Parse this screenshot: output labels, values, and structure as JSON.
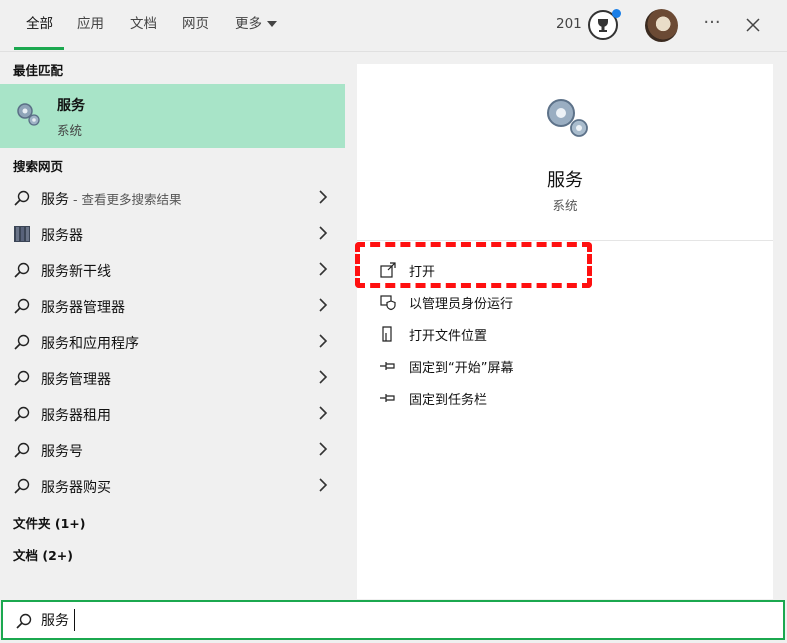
{
  "tabs": [
    {
      "label": "全部",
      "active": true
    },
    {
      "label": "应用"
    },
    {
      "label": "文档"
    },
    {
      "label": "网页"
    },
    {
      "label": "更多"
    }
  ],
  "header": {
    "points": "201",
    "more_icon": "ellipsis-icon",
    "close_icon": "close-icon"
  },
  "sections": {
    "best_match": "最佳匹配",
    "search_web": "搜索网页",
    "folders": "文件夹 (1+)",
    "documents": "文档 (2+)"
  },
  "best_match": {
    "title": "服务",
    "subtitle": "系统",
    "icon": "services-gear-icon"
  },
  "web_results": [
    {
      "label": "服务",
      "hint": " - 查看更多搜索结果",
      "icon": "search-icon"
    },
    {
      "label": "服务器",
      "hint": "",
      "icon": "server-image-icon"
    },
    {
      "label": "服务新干线",
      "hint": "",
      "icon": "search-icon"
    },
    {
      "label": "服务器管理器",
      "hint": "",
      "icon": "search-icon"
    },
    {
      "label": "服务和应用程序",
      "hint": "",
      "icon": "search-icon"
    },
    {
      "label": "服务管理器",
      "hint": "",
      "icon": "search-icon"
    },
    {
      "label": "服务器租用",
      "hint": "",
      "icon": "search-icon"
    },
    {
      "label": "服务号",
      "hint": "",
      "icon": "search-icon"
    },
    {
      "label": "服务器购买",
      "hint": "",
      "icon": "search-icon"
    }
  ],
  "detail": {
    "title": "服务",
    "subtitle": "系统",
    "actions": [
      {
        "label": "打开",
        "icon": "open-icon"
      },
      {
        "label": "以管理员身份运行",
        "icon": "admin-shield-icon"
      },
      {
        "label": "打开文件位置",
        "icon": "file-location-icon"
      },
      {
        "label": "固定到“开始”屏幕",
        "icon": "pin-icon"
      },
      {
        "label": "固定到任务栏",
        "icon": "pin-icon"
      }
    ]
  },
  "search": {
    "value": "服务"
  },
  "colors": {
    "accent": "#1ba84f",
    "selection": "#a8e4c8",
    "annotation": "#ff1010"
  }
}
